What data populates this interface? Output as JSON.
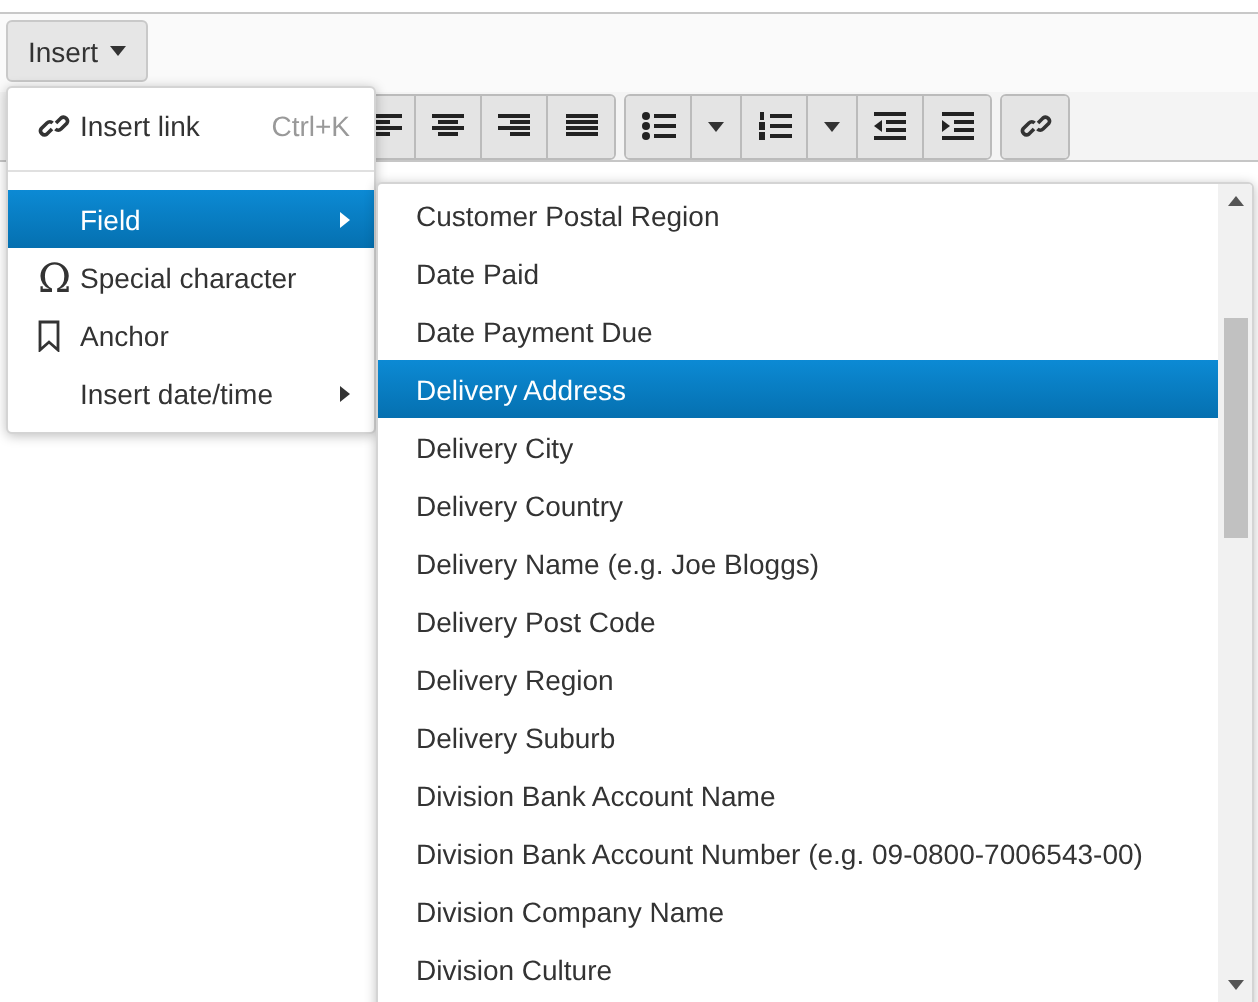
{
  "menubar": {
    "label": "Insert",
    "expanded": true
  },
  "insert_menu": {
    "items": [
      {
        "kind": "item",
        "label": "Insert link",
        "shortcut": "Ctrl+K",
        "selected": false,
        "submenu": false
      },
      {
        "kind": "separator"
      },
      {
        "kind": "item",
        "label": "Field",
        "selected": true,
        "submenu": true
      },
      {
        "kind": "item",
        "label": "Special character",
        "icon_glyph": "Ω",
        "selected": false,
        "submenu": false
      },
      {
        "kind": "item",
        "label": "Anchor",
        "selected": false,
        "submenu": false
      },
      {
        "kind": "item",
        "label": "Insert date/time",
        "selected": false,
        "submenu": true
      }
    ]
  },
  "field_submenu": {
    "items": [
      {
        "label": "Customer Postal Region",
        "selected": false
      },
      {
        "label": "Date Paid",
        "selected": false
      },
      {
        "label": "Date Payment Due",
        "selected": false
      },
      {
        "label": "Delivery Address",
        "selected": true
      },
      {
        "label": "Delivery City",
        "selected": false
      },
      {
        "label": "Delivery Country",
        "selected": false
      },
      {
        "label": "Delivery Name (e.g. Joe Bloggs)",
        "selected": false
      },
      {
        "label": "Delivery Post Code",
        "selected": false
      },
      {
        "label": "Delivery Region",
        "selected": false
      },
      {
        "label": "Delivery Suburb",
        "selected": false
      },
      {
        "label": "Division Bank Account Name",
        "selected": false
      },
      {
        "label": "Division Bank Account Number (e.g. 09-0800-7006543-00)",
        "selected": false
      },
      {
        "label": "Division Company Name",
        "selected": false
      },
      {
        "label": "Division Culture",
        "selected": false
      }
    ]
  }
}
